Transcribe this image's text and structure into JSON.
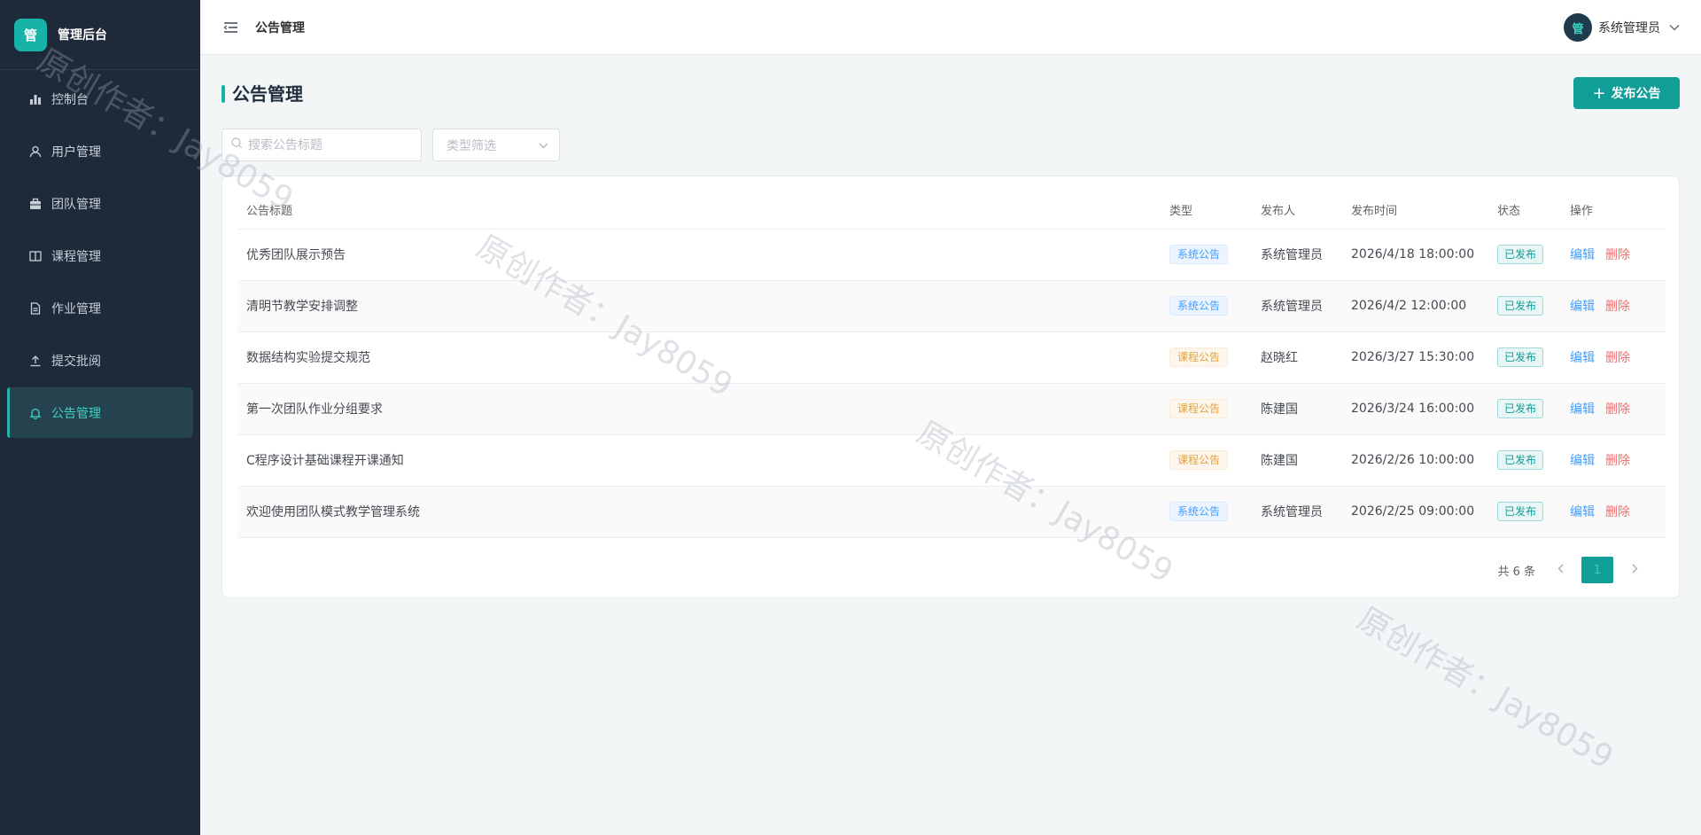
{
  "brand": {
    "logo_char": "管",
    "title": "管理后台"
  },
  "sidebar": {
    "items": [
      {
        "label": "控制台",
        "icon": "bar-chart-icon",
        "active": false
      },
      {
        "label": "用户管理",
        "icon": "user-icon",
        "active": false
      },
      {
        "label": "团队管理",
        "icon": "briefcase-icon",
        "active": false
      },
      {
        "label": "课程管理",
        "icon": "book-icon",
        "active": false
      },
      {
        "label": "作业管理",
        "icon": "document-icon",
        "active": false
      },
      {
        "label": "提交批阅",
        "icon": "upload-icon",
        "active": false
      },
      {
        "label": "公告管理",
        "icon": "bell-icon",
        "active": true
      }
    ]
  },
  "header": {
    "breadcrumb": "公告管理",
    "user": {
      "avatar_char": "管",
      "name": "系统管理员"
    }
  },
  "page": {
    "title": "公告管理",
    "publish_button": "发布公告",
    "search_placeholder": "搜索公告标题",
    "type_filter_placeholder": "类型筛选"
  },
  "table": {
    "columns": [
      "公告标题",
      "类型",
      "发布人",
      "发布时间",
      "状态",
      "操作"
    ],
    "rows": [
      {
        "title": "优秀团队展示预告",
        "type": "系统公告",
        "type_kind": "sys",
        "publisher": "系统管理员",
        "time": "2026/4/18 18:00:00",
        "status": "已发布"
      },
      {
        "title": "清明节教学安排调整",
        "type": "系统公告",
        "type_kind": "sys",
        "publisher": "系统管理员",
        "time": "2026/4/2 12:00:00",
        "status": "已发布"
      },
      {
        "title": "数据结构实验提交规范",
        "type": "课程公告",
        "type_kind": "course",
        "publisher": "赵晓红",
        "time": "2026/3/27 15:30:00",
        "status": "已发布"
      },
      {
        "title": "第一次团队作业分组要求",
        "type": "课程公告",
        "type_kind": "course",
        "publisher": "陈建国",
        "time": "2026/3/24 16:00:00",
        "status": "已发布"
      },
      {
        "title": "C程序设计基础课程开课通知",
        "type": "课程公告",
        "type_kind": "course",
        "publisher": "陈建国",
        "time": "2026/2/26 10:00:00",
        "status": "已发布"
      },
      {
        "title": "欢迎使用团队模式教学管理系统",
        "type": "系统公告",
        "type_kind": "sys",
        "publisher": "系统管理员",
        "time": "2026/2/25 09:00:00",
        "status": "已发布"
      }
    ],
    "edit_label": "编辑",
    "delete_label": "删除"
  },
  "pagination": {
    "total": "共 6 条",
    "current": "1"
  },
  "watermark": {
    "text": "原创作者：Jay8059"
  },
  "colors": {
    "sidebar_bg": "#1e2a3a",
    "accent": "#119e99",
    "active_text": "#3fd0c4"
  }
}
